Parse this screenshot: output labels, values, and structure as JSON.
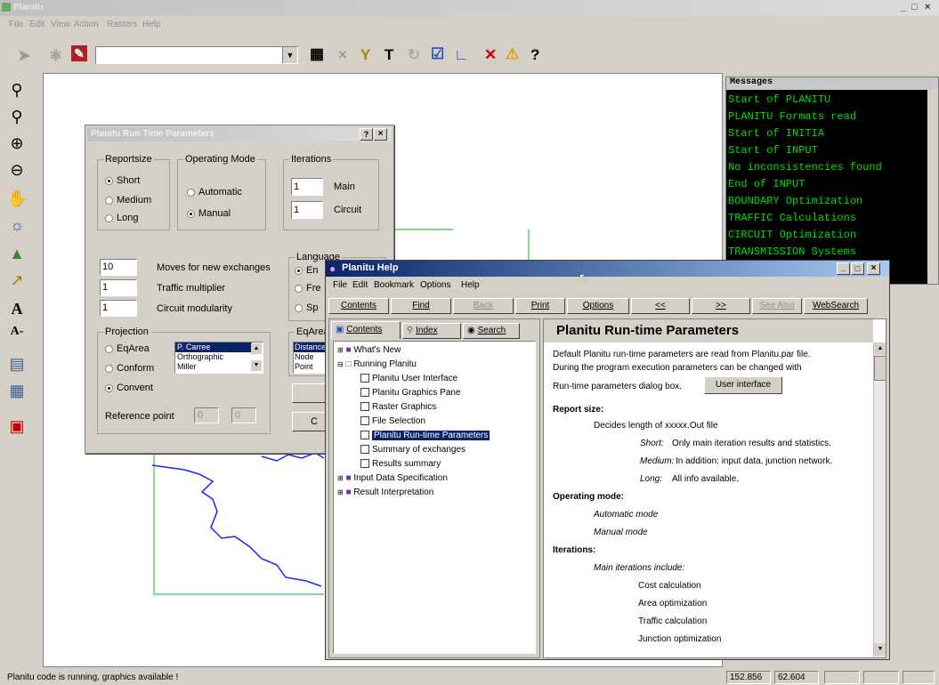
{
  "app": {
    "title": "Planitu",
    "menu": [
      "File",
      "Edit",
      "View",
      "Action",
      "Rasters",
      "Help"
    ]
  },
  "status": {
    "text": "Planitu code is running, graphics available !",
    "coord_x": "152.856",
    "coord_y": "62.604"
  },
  "messages": {
    "title": "Messages",
    "lines": [
      "Start of PLANITU",
      "PLANITU Formats read",
      "Start of INITIA",
      "Start of INPUT",
      "No inconsistencies found",
      "End of INPUT",
      "BOUNDARY Optimization",
      "TRAFFIC Calculations",
      "CIRCUIT Optimization",
      "TRANSMISSION Systems"
    ]
  },
  "params": {
    "title": "Planitu Run Time Parameters",
    "reportsize": {
      "label": "Reportsize",
      "options": [
        "Short",
        "Medium",
        "Long"
      ],
      "selected": "Short"
    },
    "opmode": {
      "label": "Operating Mode",
      "options": [
        "Automatic",
        "Manual"
      ],
      "selected": "Manual"
    },
    "iterations": {
      "label": "Iterations",
      "main_value": "1",
      "main_label": "Main",
      "circuit_value": "1",
      "circuit_label": "Circuit"
    },
    "moves_value": "10",
    "moves_label": "Moves for new exchanges",
    "traffic_value": "1",
    "traffic_label": "Traffic multiplier",
    "circuit_mod_value": "1",
    "circuit_mod_label": "Circuit modularity",
    "language": {
      "label": "Language",
      "options": [
        "En",
        "Fre",
        "Sp"
      ]
    },
    "projection": {
      "label": "Projection",
      "options": [
        "EqArea",
        "Conform",
        "Convent"
      ],
      "selected": "Convent",
      "list": [
        "P. Carree",
        "Orthographic",
        "Miller"
      ]
    },
    "eqarea": {
      "label": "EqArea",
      "list": [
        "Distance",
        "Node",
        "Point"
      ]
    },
    "reference_label": "Reference point",
    "ref_x": "0",
    "ref_y": "0",
    "cancel_label": "C"
  },
  "help": {
    "title": "Planitu Help",
    "menu": [
      "File",
      "Edit",
      "Bookmark",
      "Options",
      "Help"
    ],
    "buttons": [
      "Contents",
      "Find",
      "Back",
      "Print",
      "Options",
      "<<",
      ">>",
      "See Also",
      "WebSearch"
    ],
    "tabs": [
      "Contents",
      "Index",
      "Search"
    ],
    "tree": [
      "What's New",
      "Running Planitu",
      "Planitu User Interface",
      "Planitu Graphics Pane",
      "Raster Graphics",
      "File Selection",
      "Planitu Run-time Parameters",
      "Summary of exchanges",
      "Results summary",
      "Input Data Specification",
      "Result Interpretation"
    ],
    "content": {
      "heading": "Planitu Run-time Parameters",
      "intro1": "Default Planitu run-time parameters are read from Planitu.par file.",
      "intro2": "During the program execution parameters can be changed with",
      "intro3": "Run-time parameters dialog box.",
      "ui_button": "User interface",
      "report_heading": "Report size:",
      "report_desc": "Decides length of xxxxx.Out file",
      "short_label": "Short:",
      "short_desc": "Only main iteration results and statistics.",
      "medium_label": "Medium:",
      "medium_desc": "In addition: input data, junction network.",
      "long_label": "Long:",
      "long_desc": "All info available.",
      "opmode_heading": "Operating mode:",
      "auto_mode": "Automatic mode",
      "manual_mode": "Manual mode",
      "iter_heading": "Iterations:",
      "main_iter": "Main iterations include:",
      "steps": [
        "Cost calculation",
        "Area optimization",
        "Traffic calculation",
        "Junction optimization"
      ]
    }
  },
  "colors": {
    "message_bg": "#000000",
    "message_text": "#00e000",
    "help_title": "#0a246a",
    "selection": "#0a246a",
    "boundary_green": "#3ac43a",
    "boundary_blue": "#2020ff"
  }
}
